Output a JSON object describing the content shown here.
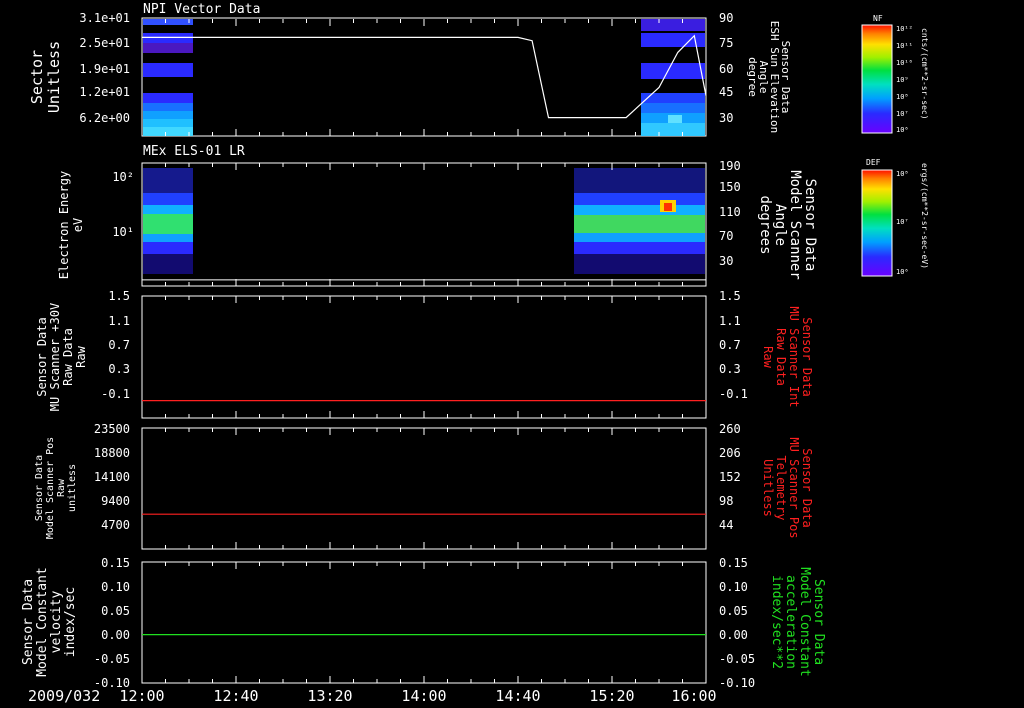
{
  "date_label": "2009/032",
  "time_ticks": [
    "12:00",
    "12:40",
    "13:20",
    "14:00",
    "14:40",
    "15:20",
    "16:00"
  ],
  "panels": [
    {
      "title": "NPI Vector Data",
      "left_label": [
        "Sector",
        "Unitless"
      ],
      "left_ticks": [
        "3.1e+01",
        "2.5e+01",
        "1.9e+01",
        "1.2e+01",
        "6.2e+00"
      ],
      "right_label": [
        "Sensor Data",
        "ESH Sun Elevation",
        "Angle",
        "degree"
      ],
      "right_label_color": "#ffffff",
      "right_ticks": [
        "90",
        "75",
        "60",
        "45",
        "30"
      ],
      "colorbar": {
        "title": "NF",
        "ticks": [
          "10¹²",
          "10¹¹",
          "10¹⁰",
          "10⁹",
          "10⁸",
          "10⁷",
          "10⁶"
        ],
        "unit": "cnts/(cm**2-sr-sec)"
      },
      "overlay": {
        "name": "Sun Elevation",
        "times": [
          "12:00",
          "14:40",
          "14:46",
          "14:53",
          "15:26",
          "15:40",
          "15:48",
          "15:55",
          "16:00"
        ],
        "values": [
          79,
          79,
          77,
          31,
          31,
          49,
          70,
          80,
          44
        ]
      }
    },
    {
      "title": "MEx ELS-01 LR",
      "left_label": [
        "Electron Energy",
        "eV"
      ],
      "left_ticks": [
        "10²",
        "10¹"
      ],
      "right_label": [
        "Sensor Data",
        "Model Scanner",
        "Angle",
        "degrees"
      ],
      "right_label_color": "#ffffff",
      "right_ticks": [
        "190",
        "150",
        "110",
        "70",
        "30"
      ],
      "colorbar": {
        "title": "DEF",
        "ticks": [
          "10⁸",
          "10⁷",
          "10⁶"
        ],
        "unit": "ergs/(cm**2-sr-sec-eV)"
      },
      "overlay": {
        "name": "Model Scanner Angle",
        "times": [
          "12:00",
          "16:00"
        ],
        "values": [
          10,
          10
        ]
      }
    },
    {
      "title": "",
      "left_label": [
        "Sensor Data",
        "MU Scanner +30V",
        "Raw Data",
        "Raw"
      ],
      "left_ticks": [
        "1.5",
        "1.1",
        "0.7",
        "0.3",
        "-0.1"
      ],
      "right_label": [
        "Sensor Data",
        "MU Scanner Int",
        "Raw Data",
        "Raw"
      ],
      "right_label_color": "#ff2020",
      "right_ticks": [
        "1.5",
        "1.1",
        "0.7",
        "0.3",
        "-0.1"
      ],
      "overlay": {
        "name": "MU Scanner Int",
        "color": "#ff2020",
        "times": [
          "12:00",
          "16:00"
        ],
        "values": [
          0,
          0
        ]
      }
    },
    {
      "title": "",
      "left_label": [
        "Sensor Data",
        "Model Scanner Pos",
        "Raw",
        "unitless"
      ],
      "left_ticks": [
        "23500",
        "18800",
        "14100",
        "9400",
        "4700"
      ],
      "right_label": [
        "Sensor Data",
        "MU Scanner Pos",
        "Telemetry",
        "Unitless"
      ],
      "right_label_color": "#ff2020",
      "right_ticks": [
        "260",
        "206",
        "152",
        "98",
        "44"
      ],
      "overlay": {
        "name": "MU Scanner Pos",
        "color": "#ff2020",
        "times": [
          "12:00",
          "16:00"
        ],
        "values": [
          89,
          89
        ]
      }
    },
    {
      "title": "",
      "left_label": [
        "Sensor Data",
        "Model Constant",
        "velocity",
        "index/sec"
      ],
      "left_ticks": [
        "0.15",
        "0.10",
        "0.05",
        "0.00",
        "-0.05",
        "-0.10"
      ],
      "right_label": [
        "Sensor Data",
        "Model Constant",
        "acceleration",
        "index/sec**2"
      ],
      "right_label_color": "#20e020",
      "right_ticks": [
        "0.15",
        "0.10",
        "0.05",
        "0.00",
        "-0.05",
        "-0.10"
      ],
      "overlay": {
        "name": "Model Constant acceleration",
        "color": "#20e020",
        "times": [
          "12:00",
          "16:00"
        ],
        "values": [
          0,
          0
        ]
      }
    }
  ],
  "chart_data": {
    "type": "line",
    "x_range": [
      "12:00",
      "16:00"
    ],
    "series": [
      {
        "name": "Sun Elevation",
        "x": [
          "12:00",
          "14:40",
          "14:46",
          "14:53",
          "15:26",
          "15:40",
          "15:48",
          "15:55",
          "16:00"
        ],
        "values": [
          79,
          79,
          77,
          31,
          31,
          49,
          70,
          80,
          44
        ]
      },
      {
        "name": "MU Scanner Int",
        "x": [
          "12:00",
          "16:00"
        ],
        "values": [
          0,
          0
        ]
      },
      {
        "name": "MU Scanner Pos",
        "x": [
          "12:00",
          "16:00"
        ],
        "values": [
          89,
          89
        ]
      },
      {
        "name": "Model Constant acceleration",
        "x": [
          "12:00",
          "16:00"
        ],
        "values": [
          0,
          0
        ]
      }
    ]
  }
}
